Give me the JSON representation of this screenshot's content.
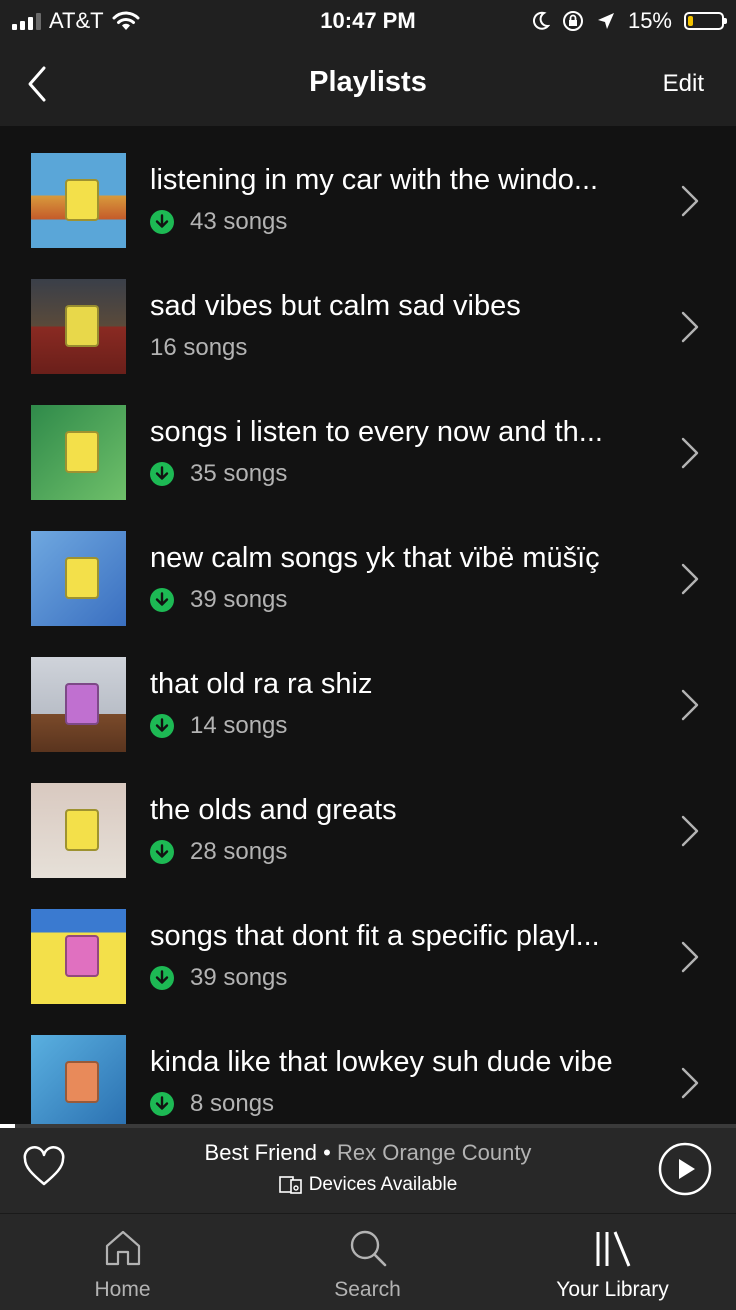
{
  "status_bar": {
    "carrier": "AT&T",
    "time": "10:47 PM",
    "battery_percent": "15%",
    "battery_level": 0.15,
    "icons": [
      "signal-icon",
      "wifi-icon",
      "moon-icon",
      "orientation-lock-icon",
      "location-arrow-icon",
      "battery-icon"
    ]
  },
  "header": {
    "title": "Playlists",
    "edit_label": "Edit",
    "back_icon": "chevron-left-icon"
  },
  "playlists": [
    {
      "name": "listening in my car with the windo...",
      "songs": "43 songs",
      "downloaded": true
    },
    {
      "name": "sad vibes but calm sad vibes",
      "songs": "16 songs",
      "downloaded": false
    },
    {
      "name": "songs i listen to every now and th...",
      "songs": "35 songs",
      "downloaded": true
    },
    {
      "name": "new calm songs yk that vïbë müšïç",
      "songs": "39 songs",
      "downloaded": true
    },
    {
      "name": "that old ra ra shiz",
      "songs": "14 songs",
      "downloaded": true
    },
    {
      "name": "the olds and greats",
      "songs": "28 songs",
      "downloaded": true
    },
    {
      "name": "songs that dont fit a specific playl...",
      "songs": "39 songs",
      "downloaded": true
    },
    {
      "name": "kinda like that lowkey suh dude vibe",
      "songs": "8 songs",
      "downloaded": true
    }
  ],
  "now_playing": {
    "track": "Best Friend",
    "separator": "•",
    "artist": "Rex Orange County",
    "devices_label": "Devices Available",
    "progress": 0.02
  },
  "tabs": [
    {
      "label": "Home",
      "icon": "home-icon",
      "active": false
    },
    {
      "label": "Search",
      "icon": "search-icon",
      "active": false
    },
    {
      "label": "Your Library",
      "icon": "library-icon",
      "active": true
    }
  ],
  "colors": {
    "background": "#121212",
    "header": "#202020",
    "player": "#282828",
    "download_green": "#1db954",
    "secondary_text": "#b3b3b3",
    "battery_yellow": "#f2c200"
  }
}
